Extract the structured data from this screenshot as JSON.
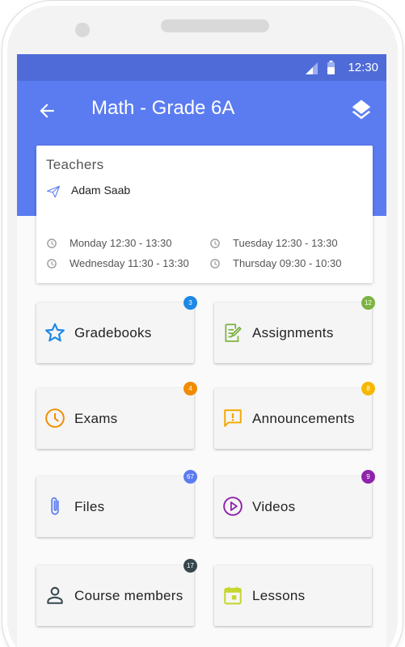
{
  "status_bar": {
    "time": "12:30"
  },
  "header": {
    "title": "Math - Grade 6A"
  },
  "teachers": {
    "heading": "Teachers",
    "name": "Adam Saab",
    "schedule": [
      "Monday 12:30 - 13:30",
      "Tuesday 12:30 - 13:30",
      "Wednesday 11:30 - 13:30",
      "Thursday 09:30 - 10:30"
    ]
  },
  "tiles": [
    {
      "label": "Gradebooks",
      "badge": "3",
      "badge_color": "#1e88e5",
      "icon": "star-icon",
      "icon_color": "#1e88e5"
    },
    {
      "label": "Assignments",
      "badge": "12",
      "badge_color": "#7cb342",
      "icon": "assignment-edit-icon",
      "icon_color": "#7cb342"
    },
    {
      "label": "Exams",
      "badge": "4",
      "badge_color": "#f08c00",
      "icon": "clock-icon",
      "icon_color": "#f08c00"
    },
    {
      "label": "Announcements",
      "badge": "8",
      "badge_color": "#f5b800",
      "icon": "announcement-icon",
      "icon_color": "#f5a800"
    },
    {
      "label": "Files",
      "badge": "67",
      "badge_color": "#5b7cf0",
      "icon": "attachment-icon",
      "icon_color": "#5b7cf0"
    },
    {
      "label": "Videos",
      "badge": "9",
      "badge_color": "#8e24aa",
      "icon": "play-circle-icon",
      "icon_color": "#8e24aa"
    },
    {
      "label": "Course members",
      "badge": "17",
      "badge_color": "#37474f",
      "icon": "person-icon",
      "icon_color": "#37474f"
    },
    {
      "label": "Lessons",
      "badge": "",
      "badge_color": "",
      "icon": "calendar-icon",
      "icon_color": "#c6d630"
    }
  ],
  "colors": {
    "primary": "#5b7cf0",
    "status_bar": "#4f6bd8"
  }
}
